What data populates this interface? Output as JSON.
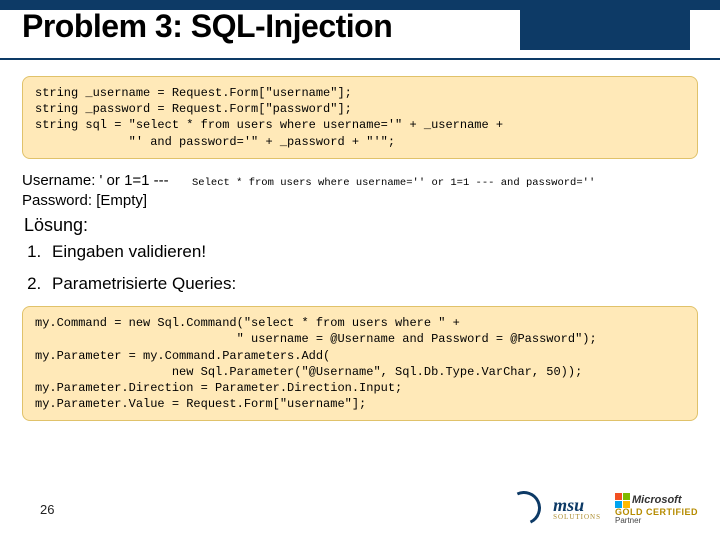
{
  "header": {
    "title": "Problem 3: SQL-Injection"
  },
  "code1": "string _username = Request.Form[\"username\"];\nstring _password = Request.Form[\"password\"];\nstring sql = \"select * from users where username='\" + _username +\n             \"' and password='\" + _password + \"'\";",
  "inputs": {
    "username_label": "Username: ' or 1=1 ---",
    "password_label": "Password: [Empty]",
    "resulting_sql": "Select * from users where username='' or 1=1 --- and password=''"
  },
  "solution_heading": "Lösung:",
  "solutions": {
    "item1": "Eingaben validieren!",
    "item2": "Parametrisierte Queries:"
  },
  "code2": "my.Command = new Sql.Command(\"select * from users where \" +\n                            \" username = @Username and Password = @Password\");\nmy.Parameter = my.Command.Parameters.Add(\n                   new Sql.Parameter(\"@Username\", Sql.Db.Type.VarChar, 50));\nmy.Parameter.Direction = Parameter.Direction.Input;\nmy.Parameter.Value = Request.Form[\"username\"];",
  "footer": {
    "page": "26",
    "msu_name": "msu",
    "msu_tag": "SOLUTIONS",
    "ms_brand": "Microsoft",
    "ms_cert": "GOLD CERTIFIED",
    "ms_partner": "Partner"
  }
}
